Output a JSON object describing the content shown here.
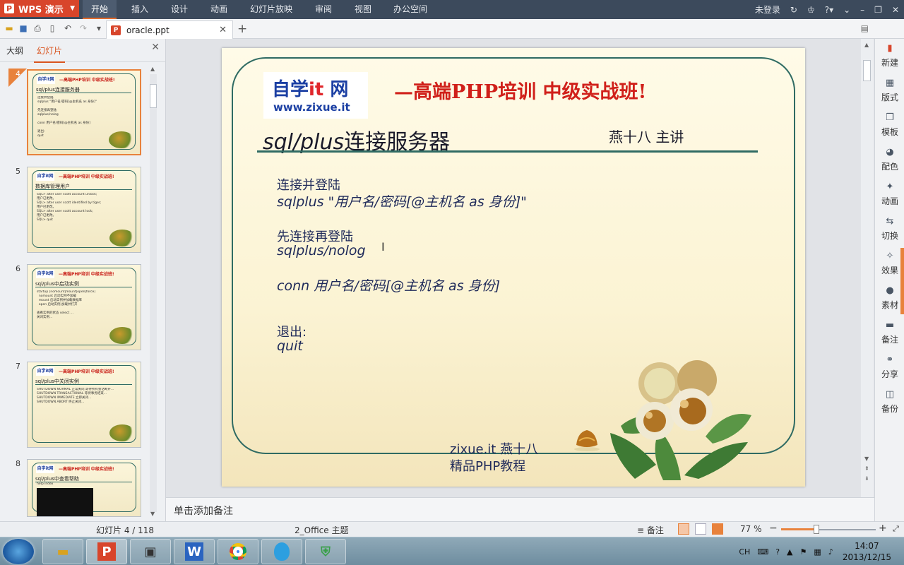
{
  "app": {
    "name": "WPS 演示",
    "menu": [
      "开始",
      "插入",
      "设计",
      "动画",
      "幻灯片放映",
      "审阅",
      "视图",
      "办公空间"
    ],
    "active_menu": "开始",
    "login": "未登录"
  },
  "document": {
    "tab_name": "oracle.ppt"
  },
  "left_panel": {
    "tabs": [
      "大纲",
      "幻灯片"
    ],
    "active_tab": "幻灯片",
    "thumbnails": [
      {
        "num": "4",
        "title": "sql/plus连接服务器",
        "selected": true,
        "text": "连接并登陆\nsqlplus \"用户名/密码[@主机名 as 身份]\"\n\n先连接再登陆\nsqlplus/nolog\n\nconn 用户名/密码[@主机名 as 身份]\n\n退出:\nquit"
      },
      {
        "num": "5",
        "title": "数据库管理用户",
        "selected": false,
        "text": "SQL> alter user scott account unlock;\n用户已更改。\nSQL> alter user scott identified by tiger;\n用户已更改。\nSQL> alter user scott account lock;\n用户已更改。\nSQL> quit"
      },
      {
        "num": "6",
        "title": "sql/plus中启动实例",
        "selected": false,
        "text": "startup [nomount|mount|open|force]\n  nomount 启动实例不加载\n  mount 启动实例并加载数据库\n  open 启动实例,加载并打开\n\n查看实例的状态 select ...\n关闭实例..."
      },
      {
        "num": "7",
        "title": "sql/plus中关闭实例",
        "selected": false,
        "text": "SHUTDOWN NORMAL 正常关闭,等待所有会话断开...\nSHUTDOWN TRANSACTIONAL 等待事务结束...\nSHUTDOWN IMMEDIATE 立即关闭...\nSHUTDOWN ABORT 终止关闭..."
      },
      {
        "num": "8",
        "title": "sql/plus中查看帮助",
        "selected": false,
        "text": "help index"
      }
    ]
  },
  "slide": {
    "logo_text_a": "自学",
    "logo_text_b": "it",
    "logo_text_c": " 网",
    "logo_url": "www.zixue.it",
    "slogan": "—高端PHP培训  中级实战班!",
    "title_en": "sql/plus",
    "title_cn": "连接服务器",
    "presenter": "燕十八 主讲",
    "lines": [
      "连接并登陆",
      "sqlplus \"用户名/密码[@主机名 as 身份]\"",
      "先连接再登陆",
      "sqlplus/nolog",
      "conn 用户名/密码[@主机名 as 身份]",
      "退出:",
      "quit"
    ],
    "footer1": "zixue.it 燕十八",
    "footer2": "精品PHP教程"
  },
  "notes_placeholder": "单击添加备注",
  "right_toolbar": [
    "新建",
    "版式",
    "模板",
    "配色",
    "动画",
    "切换",
    "效果",
    "素材",
    "备注",
    "分享",
    "备份"
  ],
  "status": {
    "slide": "幻灯片 4 / 118",
    "theme": "2_Office 主题",
    "notes_btn": "备注",
    "zoom": "77 %"
  },
  "taskbar": {
    "apps": [
      "explorer",
      "wps-presentation",
      "terminal",
      "wps-writer",
      "chrome",
      "qq",
      "security"
    ],
    "tray_lang": "CH",
    "time": "14:07",
    "date": "2013/12/15"
  },
  "colors": {
    "accent": "#d8452b",
    "menubar": "#3c4a5c",
    "frame": "#2f6b63",
    "slogan": "#d0201a"
  }
}
